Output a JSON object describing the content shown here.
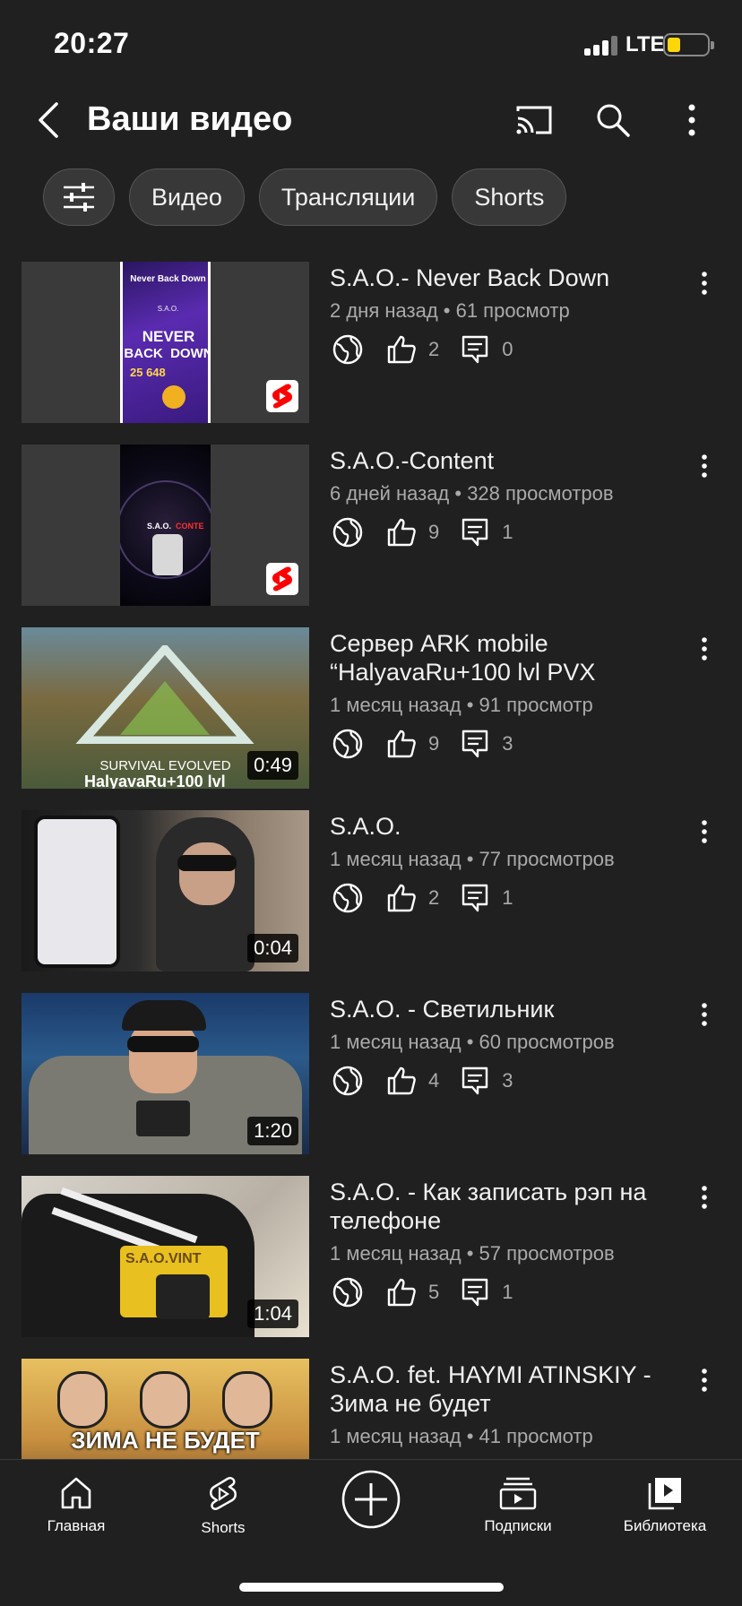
{
  "status": {
    "time": "20:27",
    "network": "LTE"
  },
  "header": {
    "title": "Ваши видео"
  },
  "chips": [
    {
      "label": "Видео"
    },
    {
      "label": "Трансляции"
    },
    {
      "label": "Shorts"
    }
  ],
  "videos": [
    {
      "title": "S.A.O.- Never Back Down",
      "meta": "2 дня назад • 61 просмотр",
      "likes": "2",
      "comments": "0",
      "duration": "",
      "is_short": true,
      "thumb_text": {
        "t1": "Never Back Down",
        "t2": "S.A.O.",
        "t3": "NEVER",
        "t4": "BACK  DOWN",
        "t5": "25 648"
      }
    },
    {
      "title": "S.A.O.-Content",
      "meta": "6 дней назад • 328 просмотров",
      "likes": "9",
      "comments": "1",
      "duration": "",
      "is_short": true,
      "thumb_text": {
        "t1": "S.A.O.",
        "t2": "CONTE"
      }
    },
    {
      "title": "Сервер ARK mobile “HalyavaRu+100 lvl PVX",
      "meta": "1 месяц назад • 91 просмотр",
      "likes": "9",
      "comments": "3",
      "duration": "0:49",
      "is_short": false,
      "thumb_text": {
        "t1": "SURVIVAL EVOLVED",
        "t2": "HalyavaRu+100 lvl"
      }
    },
    {
      "title": "S.A.O.",
      "meta": "1 месяц назад • 77 просмотров",
      "likes": "2",
      "comments": "1",
      "duration": "0:04",
      "is_short": false
    },
    {
      "title": "S.A.O. - Светильник",
      "meta": "1 месяц назад • 60 просмотров",
      "likes": "4",
      "comments": "3",
      "duration": "1:20",
      "is_short": false
    },
    {
      "title": "S.A.O. - Как записать рэп на телефоне",
      "meta": "1 месяц назад • 57 просмотров",
      "likes": "5",
      "comments": "1",
      "duration": "1:04",
      "is_short": false,
      "thumb_text": {
        "t1": "S.A.O.VINT"
      }
    },
    {
      "title": "S.A.O. fet. HAYMI ATINSKIY - Зима не будет",
      "meta": "1 месяц назад • 41 просмотр",
      "likes": "",
      "comments": "",
      "duration": "",
      "is_short": false,
      "thumb_text": {
        "t1": "ЗИМА НЕ БУДЕТ"
      }
    }
  ],
  "bottom_nav": [
    {
      "label": "Главная",
      "icon": "home-icon"
    },
    {
      "label": "Shorts",
      "icon": "shorts-icon"
    },
    {
      "label": "",
      "icon": "create-icon"
    },
    {
      "label": "Подписки",
      "icon": "subscriptions-icon"
    },
    {
      "label": "Библиотека",
      "icon": "library-icon"
    }
  ],
  "colors": {
    "background": "#202020",
    "chip": "#383838",
    "meta_text": "#aaaaaa",
    "shorts_red": "#ff0000",
    "battery": "#ffd60a"
  }
}
